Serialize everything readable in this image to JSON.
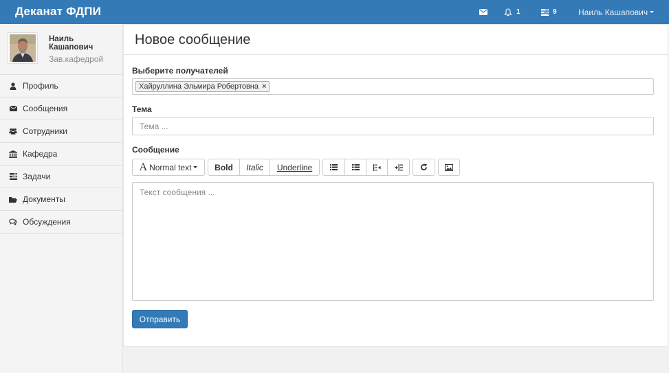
{
  "topbar": {
    "brand": "Деканат ФДПИ",
    "messages_icon": "envelope-icon",
    "notifications_icon": "bell-icon",
    "notifications_count": "1",
    "tasks_icon": "tasks-icon",
    "tasks_count": "9",
    "user_name": "Наиль Кашапович"
  },
  "sidebar": {
    "profile": {
      "name": "Наиль Кашапович",
      "role": "Зав.кафедрой"
    },
    "items": [
      {
        "label": "Профиль",
        "icon": "user-icon"
      },
      {
        "label": "Сообщения",
        "icon": "envelope-icon"
      },
      {
        "label": "Сотрудники",
        "icon": "users-icon"
      },
      {
        "label": "Кафедра",
        "icon": "institution-icon"
      },
      {
        "label": "Задачи",
        "icon": "tasks-icon"
      },
      {
        "label": "Документы",
        "icon": "folder-icon"
      },
      {
        "label": "Обсуждения",
        "icon": "comments-icon"
      }
    ]
  },
  "main": {
    "title": "Новое сообщение",
    "recipients_label": "Выберите получателей",
    "recipient_tag": "Хайруллина Эльмира Робертовна",
    "recipient_remove": "×",
    "topic_label": "Тема",
    "topic_placeholder": "Тема ...",
    "message_label": "Сообщение",
    "toolbar": {
      "font_glyph": "A",
      "font_label": "Normal text",
      "bold": "Bold",
      "italic": "Italic",
      "underline": "Underline"
    },
    "message_placeholder": "Текст сообщения ...",
    "send_label": "Отправить"
  }
}
